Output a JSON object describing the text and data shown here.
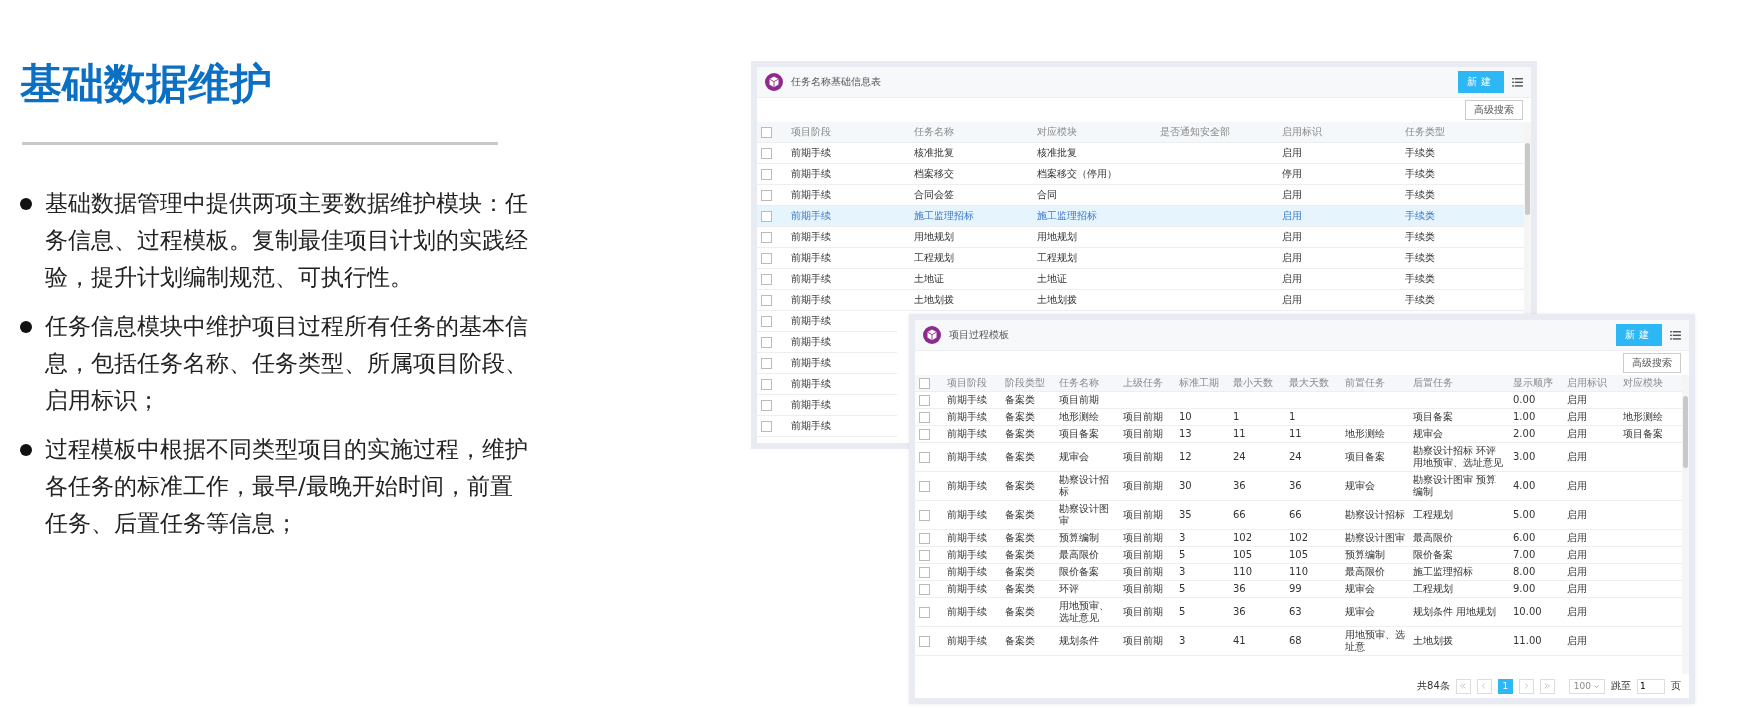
{
  "slide": {
    "title": "基础数据维护",
    "bullets": [
      "基础数据管理中提供两项主要数据维护模块：任务信息、过程模板。复制最佳项目计划的实践经验，提升计划编制规范、可执行性。",
      "任务信息模块中维护项目过程所有任务的基本信息，包括任务名称、任务类型、所属项目阶段、启用标识；",
      "过程模板中根据不同类型项目的实施过程，维护各任务的标准工作，最早/最晚开始时间，前置任务、后置任务等信息；"
    ]
  },
  "task_table": {
    "title": "任务名称基础信息表",
    "new_button": "新建",
    "search_button": "高级搜索",
    "header_checked": false,
    "columns": [
      "项目阶段",
      "任务名称",
      "对应模块",
      "是否通知安全部",
      "启用标识",
      "任务类型"
    ],
    "rows": [
      {
        "cells": [
          "前期手续",
          "核准批复",
          "核准批复",
          null,
          "启用",
          "手续类"
        ],
        "checked": false,
        "selected": false
      },
      {
        "cells": [
          "前期手续",
          "档案移交",
          "档案移交（停用）",
          null,
          "停用",
          "手续类"
        ],
        "checked": false,
        "selected": false
      },
      {
        "cells": [
          "前期手续",
          "合同会签",
          "合同",
          null,
          "启用",
          "手续类"
        ],
        "checked": false,
        "selected": false
      },
      {
        "cells": [
          "前期手续",
          "施工监理招标",
          "施工监理招标",
          null,
          "启用",
          "手续类"
        ],
        "checked": false,
        "selected": true
      },
      {
        "cells": [
          "前期手续",
          "用地规划",
          "用地规划",
          null,
          "启用",
          "手续类"
        ],
        "checked": false,
        "selected": false
      },
      {
        "cells": [
          "前期手续",
          "工程规划",
          "工程规划",
          null,
          "启用",
          "手续类"
        ],
        "checked": false,
        "selected": false
      },
      {
        "cells": [
          "前期手续",
          "土地证",
          "土地证",
          null,
          "启用",
          "手续类"
        ],
        "checked": false,
        "selected": false
      },
      {
        "cells": [
          "前期手续",
          "土地划拨",
          "土地划拨",
          null,
          "启用",
          "手续类"
        ],
        "checked": false,
        "selected": false
      },
      {
        "cells": [
          "前期手续"
        ],
        "checked": false,
        "selected": false
      },
      {
        "cells": [
          "前期手续"
        ],
        "checked": false,
        "selected": false
      },
      {
        "cells": [
          "前期手续"
        ],
        "checked": false,
        "selected": false
      },
      {
        "cells": [
          "前期手续"
        ],
        "checked": false,
        "selected": false
      },
      {
        "cells": [
          "前期手续"
        ],
        "checked": false,
        "selected": false
      },
      {
        "cells": [
          "前期手续"
        ],
        "checked": false,
        "selected": false
      }
    ]
  },
  "template_table": {
    "title": "项目过程模板",
    "new_button": "新建",
    "search_button": "高级搜索",
    "header_checked": false,
    "columns": [
      "项目阶段",
      "阶段类型",
      "任务名称",
      "上级任务",
      "标准工期",
      "最小天数",
      "最大天数",
      "前置任务",
      "后置任务",
      "显示顺序",
      "启用标识",
      "对应模块"
    ],
    "rows": [
      {
        "cells": [
          "前期手续",
          "备案类",
          "项目前期",
          null,
          null,
          null,
          null,
          null,
          null,
          "0.00",
          "启用",
          null
        ],
        "checked": false,
        "selected": false
      },
      {
        "cells": [
          "前期手续",
          "备案类",
          "地形测绘",
          "项目前期",
          "10",
          "1",
          "1",
          null,
          "项目备案",
          "1.00",
          "启用",
          "地形测绘"
        ],
        "checked": false,
        "selected": false
      },
      {
        "cells": [
          "前期手续",
          "备案类",
          "项目备案",
          "项目前期",
          "13",
          "11",
          "11",
          "地形测绘",
          "规审会",
          "2.00",
          "启用",
          "项目备案"
        ],
        "checked": false,
        "selected": false
      },
      {
        "cells": [
          "前期手续",
          "备案类",
          "规审会",
          "项目前期",
          "12",
          "24",
          "24",
          "项目备案",
          "勘察设计招标 环评用地预审、选址意见",
          "3.00",
          "启用",
          null
        ],
        "checked": false,
        "selected": false
      },
      {
        "cells": [
          "前期手续",
          "备案类",
          "勘察设计招标",
          "项目前期",
          "30",
          "36",
          "36",
          "规审会",
          "勘察设计图审 预算编制",
          "4.00",
          "启用",
          null
        ],
        "checked": false,
        "selected": false
      },
      {
        "cells": [
          "前期手续",
          "备案类",
          "勘察设计图审",
          "项目前期",
          "35",
          "66",
          "66",
          "勘察设计招标",
          "工程规划",
          "5.00",
          "启用",
          null
        ],
        "checked": false,
        "selected": false
      },
      {
        "cells": [
          "前期手续",
          "备案类",
          "预算编制",
          "项目前期",
          "3",
          "102",
          "102",
          "勘察设计图审",
          "最高限价",
          "6.00",
          "启用",
          null
        ],
        "checked": false,
        "selected": false
      },
      {
        "cells": [
          "前期手续",
          "备案类",
          "最高限价",
          "项目前期",
          "5",
          "105",
          "105",
          "预算编制",
          "限价备案",
          "7.00",
          "启用",
          null
        ],
        "checked": false,
        "selected": false
      },
      {
        "cells": [
          "前期手续",
          "备案类",
          "限价备案",
          "项目前期",
          "3",
          "110",
          "110",
          "最高限价",
          "施工监理招标",
          "8.00",
          "启用",
          null
        ],
        "checked": false,
        "selected": false
      },
      {
        "cells": [
          "前期手续",
          "备案类",
          "环评",
          "项目前期",
          "5",
          "36",
          "99",
          "规审会",
          "工程规划",
          "9.00",
          "启用",
          null
        ],
        "checked": false,
        "selected": false
      },
      {
        "cells": [
          "前期手续",
          "备案类",
          "用地预审、选址意见",
          "项目前期",
          "5",
          "36",
          "63",
          "规审会",
          "规划条件 用地规划",
          "10.00",
          "启用",
          null
        ],
        "checked": false,
        "selected": false
      },
      {
        "cells": [
          "前期手续",
          "备案类",
          "规划条件",
          "项目前期",
          "3",
          "41",
          "68",
          "用地预审、选址意",
          "土地划拨",
          "11.00",
          "启用",
          null
        ],
        "checked": false,
        "selected": false
      }
    ],
    "pagination": {
      "total": "共84条",
      "pages": [
        {
          "label": "1",
          "selected": true
        }
      ],
      "page_size": "100",
      "jump_label": "跳至",
      "jump_value": "1",
      "page_unit": "页"
    }
  }
}
